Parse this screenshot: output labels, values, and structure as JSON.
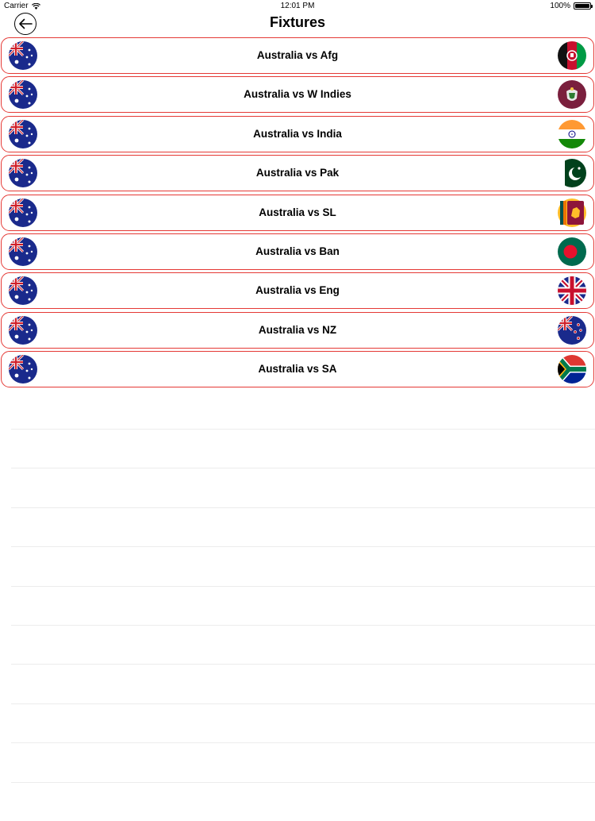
{
  "status_bar": {
    "carrier": "Carrier",
    "time": "12:01 PM",
    "battery": "100%"
  },
  "nav": {
    "title": "Fixtures"
  },
  "fixtures": [
    {
      "label": "Australia vs Afg",
      "left_flag": "australia-flag-icon",
      "right_flag": "afghanistan-flag-icon"
    },
    {
      "label": "Australia vs W Indies",
      "left_flag": "australia-flag-icon",
      "right_flag": "west-indies-flag-icon"
    },
    {
      "label": "Australia vs India",
      "left_flag": "australia-flag-icon",
      "right_flag": "india-flag-icon"
    },
    {
      "label": "Australia vs Pak",
      "left_flag": "australia-flag-icon",
      "right_flag": "pakistan-flag-icon"
    },
    {
      "label": "Australia vs SL",
      "left_flag": "australia-flag-icon",
      "right_flag": "sri-lanka-flag-icon"
    },
    {
      "label": "Australia vs Ban",
      "left_flag": "australia-flag-icon",
      "right_flag": "bangladesh-flag-icon"
    },
    {
      "label": "Australia vs Eng",
      "left_flag": "australia-flag-icon",
      "right_flag": "england-flag-icon"
    },
    {
      "label": "Australia vs NZ",
      "left_flag": "australia-flag-icon",
      "right_flag": "new-zealand-flag-icon"
    },
    {
      "label": "Australia vs SA",
      "left_flag": "australia-flag-icon",
      "right_flag": "south-africa-flag-icon"
    }
  ],
  "colors": {
    "row_border": "#e53935",
    "separator": "#ececec"
  }
}
